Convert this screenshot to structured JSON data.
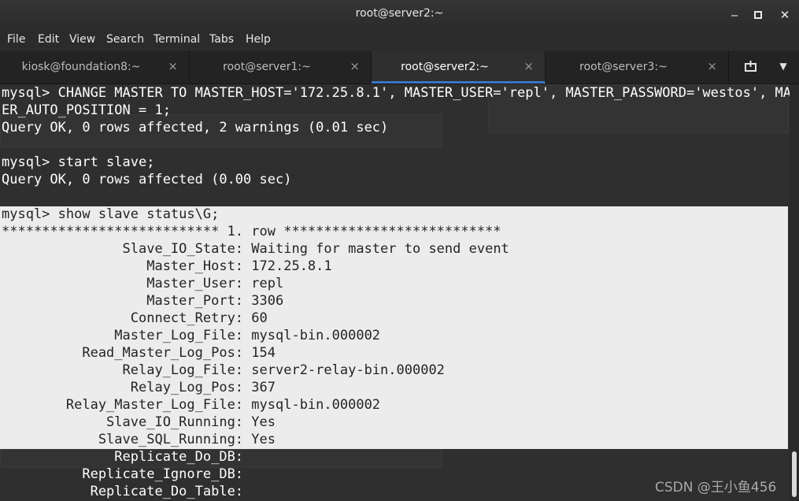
{
  "window": {
    "title": "root@server2:~"
  },
  "menu": [
    "File",
    "Edit",
    "View",
    "Search",
    "Terminal",
    "Tabs",
    "Help"
  ],
  "tabs": [
    {
      "label": "kiosk@foundation8:~",
      "close": "×",
      "active": false
    },
    {
      "label": "root@server1:~",
      "close": "×",
      "active": false
    },
    {
      "label": "root@server2:~",
      "close": "×",
      "active": true
    },
    {
      "label": "root@server3:~",
      "close": "×",
      "active": false
    }
  ],
  "terminal": {
    "lines": [
      "mysql> CHANGE MASTER TO MASTER_HOST='172.25.8.1', MASTER_USER='repl', MASTER_PASSWORD='westos', MAST",
      "ER_AUTO_POSITION = 1;",
      "Query OK, 0 rows affected, 2 warnings (0.01 sec)",
      "",
      "mysql> start slave;",
      "Query OK, 0 rows affected (0.00 sec)",
      "",
      "mysql> show slave status\\G;",
      "*************************** 1. row ***************************",
      "               Slave_IO_State: Waiting for master to send event",
      "                  Master_Host: 172.25.8.1",
      "                  Master_User: repl",
      "                  Master_Port: 3306",
      "                Connect_Retry: 60",
      "              Master_Log_File: mysql-bin.000002",
      "          Read_Master_Log_Pos: 154",
      "               Relay_Log_File: server2-relay-bin.000002",
      "                Relay_Log_Pos: 367",
      "        Relay_Master_Log_File: mysql-bin.000002",
      "             Slave_IO_Running: Yes",
      "            Slave_SQL_Running: Yes",
      "              Replicate_Do_DB:",
      "          Replicate_Ignore_DB:",
      "           Replicate_Do_Table:"
    ]
  },
  "watermark": "CSDN @王小鱼456"
}
